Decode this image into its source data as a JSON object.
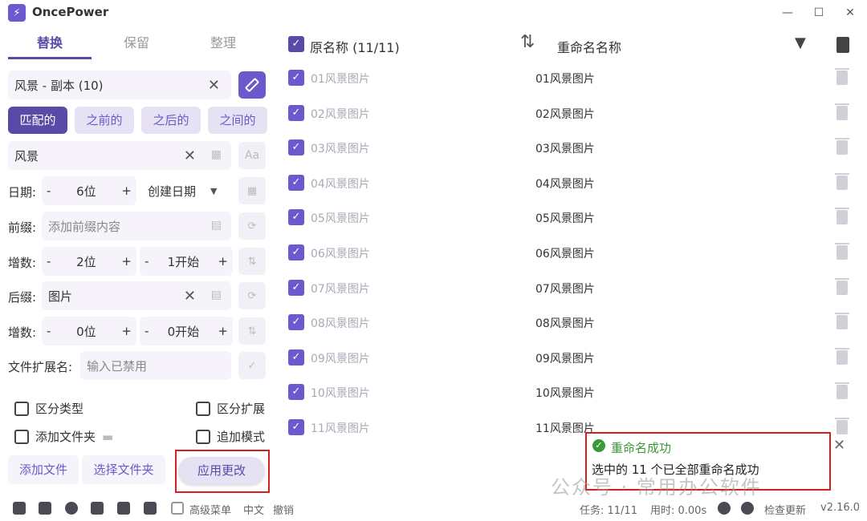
{
  "app": {
    "title": "OncePower",
    "logo_glyph": "⚡"
  },
  "window": {
    "minimize": "—",
    "maximize": "☐",
    "close": "✕"
  },
  "tabs": [
    {
      "label": "替换",
      "active": true
    },
    {
      "label": "保留",
      "active": false
    },
    {
      "label": "整理",
      "active": false
    }
  ],
  "search": {
    "value": "风景 - 副本 (10)"
  },
  "match_modes": [
    {
      "label": "匹配的",
      "active": true
    },
    {
      "label": "之前的",
      "active": false
    },
    {
      "label": "之后的",
      "active": false
    },
    {
      "label": "之间的",
      "active": false
    }
  ],
  "replace": {
    "value": "风景",
    "case_button": "Aa"
  },
  "date": {
    "label": "日期:",
    "digits": "6位",
    "type": "创建日期"
  },
  "prefix": {
    "label": "前缀:",
    "placeholder": "添加前缀内容"
  },
  "increment1": {
    "label": "增数:",
    "digits": "2位",
    "start": "1开始"
  },
  "suffix": {
    "label": "后缀:",
    "value": "图片"
  },
  "increment2": {
    "label": "增数:",
    "digits": "0位",
    "start": "0开始"
  },
  "extension": {
    "label": "文件扩展名:",
    "placeholder": "输入已禁用"
  },
  "options": {
    "distinguish_type": "区分类型",
    "distinguish_ext": "区分扩展",
    "add_folder": "添加文件夹",
    "append_mode": "追加模式"
  },
  "actions": {
    "add_files": "添加文件",
    "select_folder": "选择文件夹",
    "apply": "应用更改"
  },
  "list": {
    "header_original": "原名称 (11/11)",
    "header_renamed": "重命名名称",
    "rows": [
      {
        "original": "01风景图片",
        "renamed": "01风景图片"
      },
      {
        "original": "02风景图片",
        "renamed": "02风景图片"
      },
      {
        "original": "03风景图片",
        "renamed": "03风景图片"
      },
      {
        "original": "04风景图片",
        "renamed": "04风景图片"
      },
      {
        "original": "05风景图片",
        "renamed": "05风景图片"
      },
      {
        "original": "06风景图片",
        "renamed": "06风景图片"
      },
      {
        "original": "07风景图片",
        "renamed": "07风景图片"
      },
      {
        "original": "08风景图片",
        "renamed": "08风景图片"
      },
      {
        "original": "09风景图片",
        "renamed": "09风景图片"
      },
      {
        "original": "10风景图片",
        "renamed": "10风景图片"
      },
      {
        "original": "11风景图片",
        "renamed": "11风景图片"
      }
    ]
  },
  "toast": {
    "title": "重命名成功",
    "message": "选中的 11 个已全部重命名成功"
  },
  "watermark": "公众号 · 常用办公软件",
  "status": {
    "advanced_menu": "高级菜单",
    "language": "中文",
    "undo": "撤销",
    "tasks": "任务: 11/11",
    "time": "用时: 0.00s",
    "check_update": "检查更新",
    "version": "v2.16.0"
  },
  "colors": {
    "accent": "#5a4aa8",
    "accent_light": "#e6e2f3",
    "success": "#3a9a3a",
    "highlight": "#d42020"
  }
}
